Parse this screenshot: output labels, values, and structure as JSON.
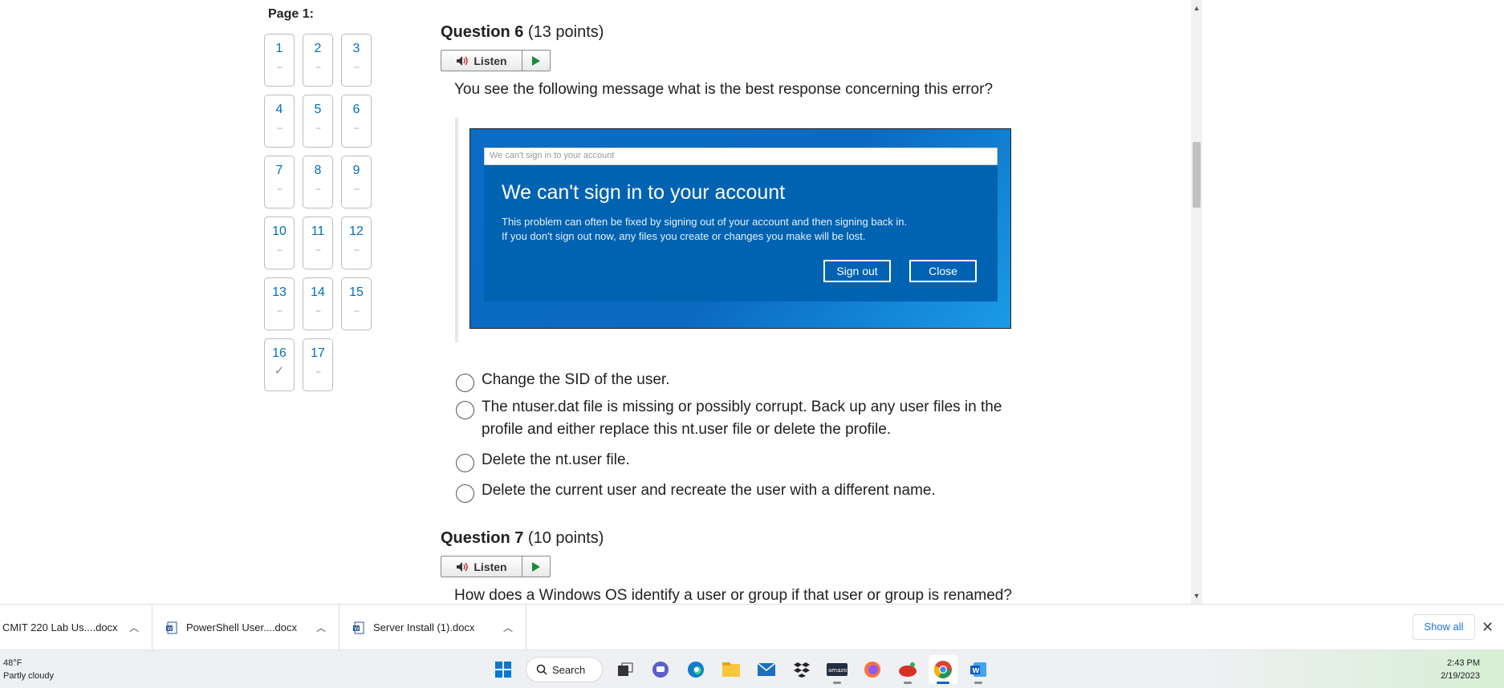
{
  "quiz": {
    "page_label": "Page 1:",
    "nav": [
      {
        "num": "1",
        "status": "--"
      },
      {
        "num": "2",
        "status": "--"
      },
      {
        "num": "3",
        "status": "--"
      },
      {
        "num": "4",
        "status": "--"
      },
      {
        "num": "5",
        "status": "--"
      },
      {
        "num": "6",
        "status": "--"
      },
      {
        "num": "7",
        "status": "--"
      },
      {
        "num": "8",
        "status": "--"
      },
      {
        "num": "9",
        "status": "--"
      },
      {
        "num": "10",
        "status": "--"
      },
      {
        "num": "11",
        "status": "--"
      },
      {
        "num": "12",
        "status": "--"
      },
      {
        "num": "13",
        "status": "--"
      },
      {
        "num": "14",
        "status": "--"
      },
      {
        "num": "15",
        "status": "--"
      },
      {
        "num": "16",
        "status": "✓"
      },
      {
        "num": "17",
        "status": "--"
      }
    ],
    "q6": {
      "title": "Question 6",
      "points": "(13 points)",
      "listen_label": "Listen",
      "text": "You see the following message what is the best response concerning this error?",
      "image": {
        "bar_text": "We can't sign in to your account",
        "heading": "We can't sign in to your account",
        "line1": "This problem can often be fixed by signing out of your account and then signing back in.",
        "line2": "If you don't sign out now, any files you create or changes you make will be lost.",
        "signout_label": "Sign out",
        "close_label": "Close"
      },
      "options": [
        "Change the SID of the user.",
        "The ntuser.dat file is missing or possibly corrupt. Back up any user files in the profile and either replace this nt.user file or delete the profile.",
        "Delete the nt.user file.",
        "Delete the current user and recreate the user with a different name."
      ]
    },
    "q7": {
      "title": "Question 7",
      "points": "(10 points)",
      "listen_label": "Listen",
      "text": "How does a Windows OS identify a user or group if that user or group is renamed?"
    }
  },
  "downloads": {
    "items": [
      "CMIT 220 Lab Us....docx",
      "PowerShell User....docx",
      "Server Install (1).docx"
    ],
    "show_all": "Show all"
  },
  "taskbar": {
    "temp": "48°F",
    "weather": "Partly cloudy",
    "search_label": "Search",
    "time": "2:43 PM",
    "date": "2/19/2023"
  },
  "colors": {
    "link": "#006fbf",
    "win_blue": "#0063b1",
    "accent": "#1a73e8"
  }
}
